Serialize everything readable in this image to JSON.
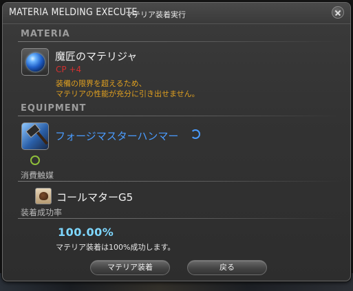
{
  "window": {
    "title": "MATERIA MELDING EXECUTE",
    "subtitle": "マテリア装着実行",
    "close_icon": "close-icon"
  },
  "materia_section": {
    "heading": "MATERIA",
    "name": "魔匠のマテリジャ",
    "cp_bonus": "CP +4",
    "warning_line1": "装備の限界を超えるため、",
    "warning_line2": "マテリアの性能が充分に引き出せません。",
    "icon": "blue-materia-orb-icon",
    "cp_color": "#d23030",
    "warning_color": "#e0a020"
  },
  "equipment_section": {
    "heading": "EQUIPMENT",
    "name": "フォージマスターハンマー",
    "icon": "hammer-icon",
    "hq_icon": "high-quality-icon",
    "slot_icon": "materia-slot-icon",
    "name_color": "#4a9cff"
  },
  "catalyst_section": {
    "heading": "消費触媒",
    "name": "コールマターG5",
    "icon": "catalyst-icon"
  },
  "success_section": {
    "heading": "装着成功率",
    "rate": "100.00%",
    "note": "マテリア装着は100%成功します。",
    "rate_color": "#7ed7ff"
  },
  "buttons": {
    "meld": "マテリア装着",
    "back": "戻る"
  }
}
